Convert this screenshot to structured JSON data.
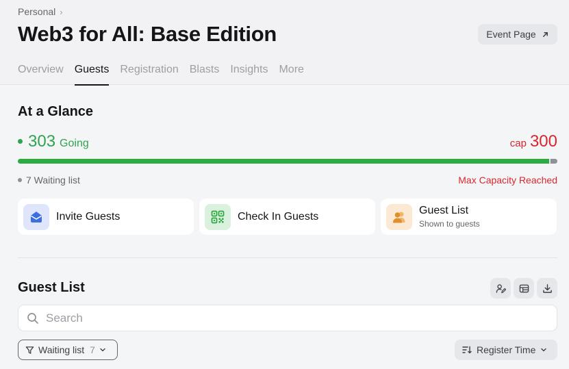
{
  "breadcrumb": {
    "parent": "Personal"
  },
  "event": {
    "title": "Web3 for All: Base Edition",
    "event_page_label": "Event Page"
  },
  "tabs": [
    {
      "label": "Overview",
      "active": false
    },
    {
      "label": "Guests",
      "active": true
    },
    {
      "label": "Registration",
      "active": false
    },
    {
      "label": "Blasts",
      "active": false
    },
    {
      "label": "Insights",
      "active": false
    },
    {
      "label": "More",
      "active": false
    }
  ],
  "glance": {
    "title": "At a Glance",
    "going_count": "303",
    "going_label": "Going",
    "cap_label": "cap",
    "cap_value": "300",
    "capacity_fill_fraction": 0.985,
    "waiting_text": "7 Waiting list",
    "capacity_status": "Max Capacity Reached"
  },
  "actions": [
    {
      "label": "Invite Guests",
      "icon": "invite-envelope-icon"
    },
    {
      "label": "Check In Guests",
      "icon": "qr-code-icon"
    },
    {
      "label": "Guest List",
      "sub": "Shown to guests",
      "icon": "people-icon"
    }
  ],
  "guest_list": {
    "title": "Guest List",
    "search_placeholder": "Search",
    "filter_label": "Waiting list",
    "filter_count": "7",
    "sort_label": "Register Time"
  },
  "colors": {
    "accent_green": "#2ea44f",
    "alert_red": "#d9262e",
    "invite_blue": "#3b6fe0",
    "checkin_green": "#2eaa43",
    "guestlist_orange": "#e79c3c"
  }
}
